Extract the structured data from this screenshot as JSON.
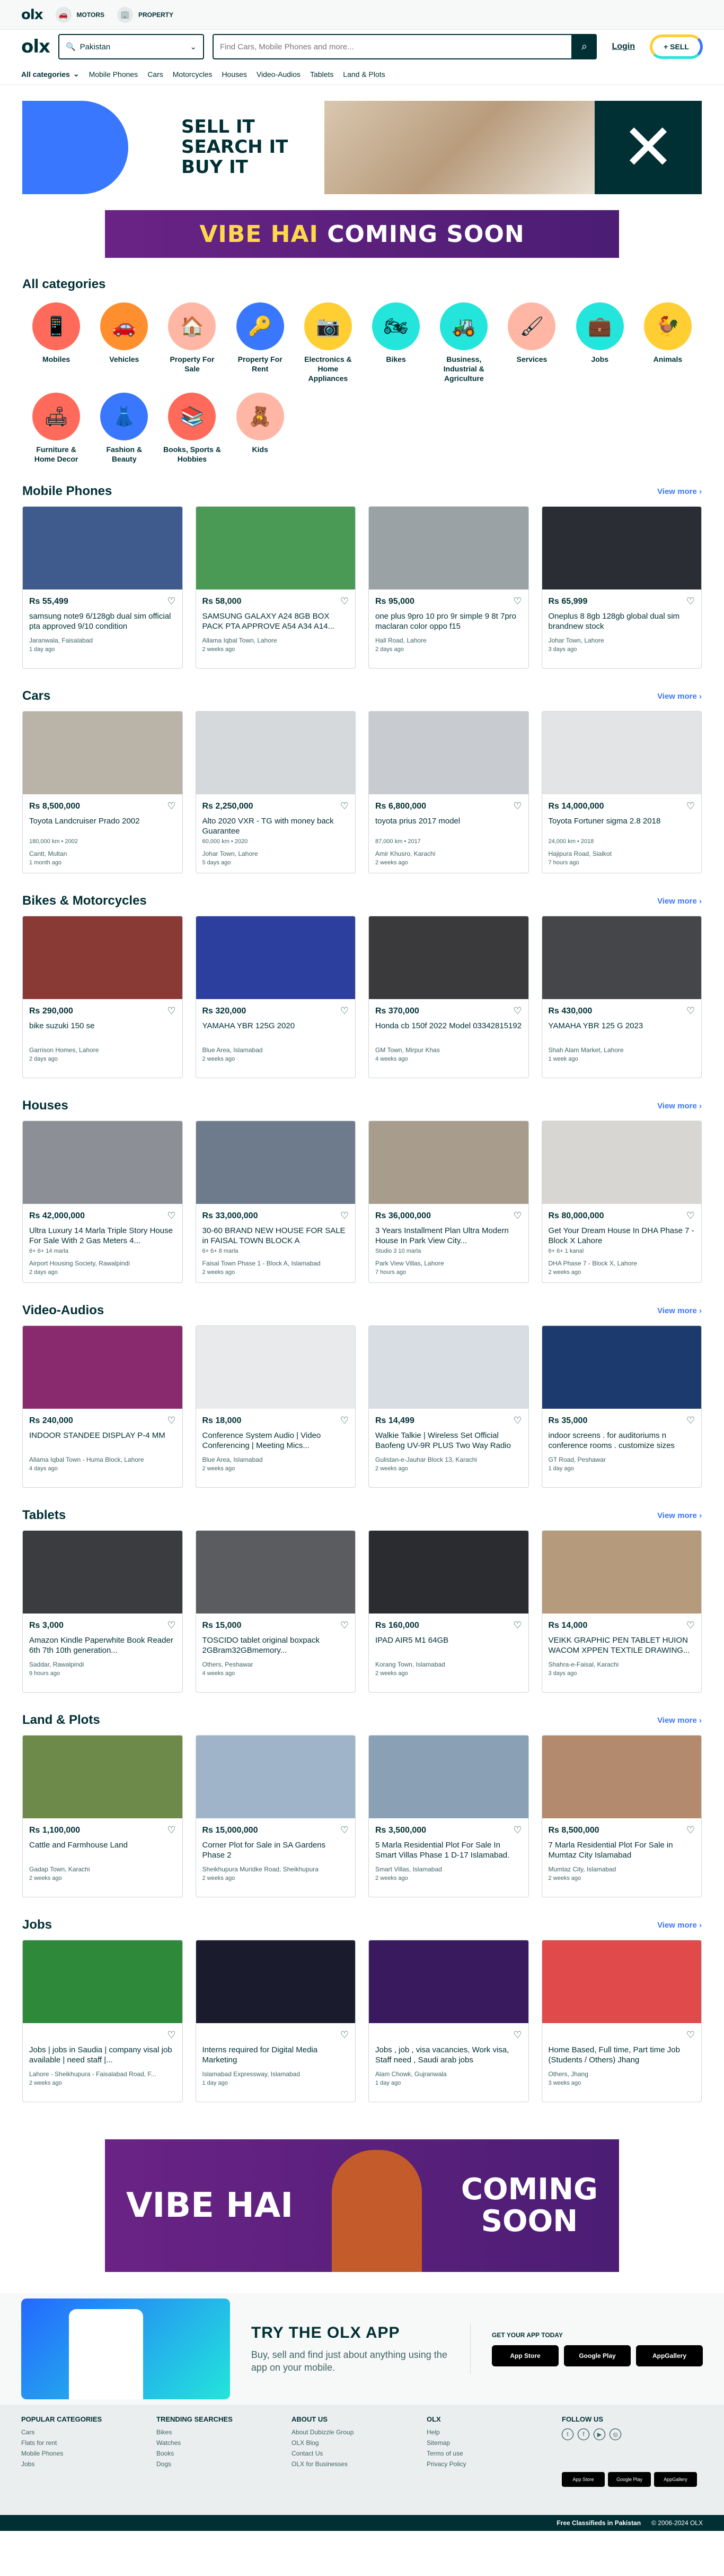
{
  "topbar": {
    "motors": "MOTORS",
    "property": "PROPERTY"
  },
  "header": {
    "location": "Pakistan",
    "search_placeholder": "Find Cars, Mobile Phones and more...",
    "login": "Login",
    "sell": "SELL"
  },
  "catnav": {
    "all": "All categories",
    "items": [
      "Mobile Phones",
      "Cars",
      "Motorcycles",
      "Houses",
      "Video-Audios",
      "Tablets",
      "Land & Plots"
    ]
  },
  "hero": {
    "l1": "SELL IT",
    "l2": "SEARCH IT",
    "l3": "BUY IT"
  },
  "ad1": {
    "a": "VIBE HAI",
    "b": "COMING SOON"
  },
  "categories": {
    "title": "All categories",
    "items": [
      {
        "label": "Mobiles",
        "icon": "📱",
        "bg": "#ff6a5a"
      },
      {
        "label": "Vehicles",
        "icon": "🚗",
        "bg": "#ff8f2e"
      },
      {
        "label": "Property For Sale",
        "icon": "🏠",
        "bg": "#ffb6a5"
      },
      {
        "label": "Property For Rent",
        "icon": "🔑",
        "bg": "#3a77ff"
      },
      {
        "label": "Electronics & Home Appliances",
        "icon": "📷",
        "bg": "#ffce32"
      },
      {
        "label": "Bikes",
        "icon": "🏍",
        "bg": "#23e5db"
      },
      {
        "label": "Business, Industrial & Agriculture",
        "icon": "🚜",
        "bg": "#23e5db"
      },
      {
        "label": "Services",
        "icon": "🖌",
        "bg": "#ffb6a5"
      },
      {
        "label": "Jobs",
        "icon": "💼",
        "bg": "#23e5db"
      },
      {
        "label": "Animals",
        "icon": "🐓",
        "bg": "#ffce32"
      },
      {
        "label": "Furniture & Home Decor",
        "icon": "🛋",
        "bg": "#ff6a5a"
      },
      {
        "label": "Fashion & Beauty",
        "icon": "👗",
        "bg": "#3a77ff"
      },
      {
        "label": "Books, Sports & Hobbies",
        "icon": "📚",
        "bg": "#ff6a5a"
      },
      {
        "label": "Kids",
        "icon": "🧸",
        "bg": "#ffb6a5"
      }
    ]
  },
  "view_more": "View more",
  "sections": [
    {
      "title": "Mobile Phones",
      "items": [
        {
          "price": "Rs 55,499",
          "title": "samsung note9 6/128gb dual sim official pta approved 9/10 condition",
          "meta": "",
          "loc": "Jaranwala, Faisalabad",
          "date": "1 day ago",
          "img": "#3f5a8c"
        },
        {
          "price": "Rs 58,000",
          "title": "SAMSUNG GALAXY A24 8GB BOX PACK PTA APPROVE A54 A34 A14...",
          "meta": "",
          "loc": "Allama Iqbal Town, Lahore",
          "date": "2 weeks ago",
          "img": "#4a9a55"
        },
        {
          "price": "Rs 95,000",
          "title": "one plus 9pro 10 pro 9r simple 9 8t 7pro maclaran color oppo f15",
          "meta": "",
          "loc": "Hall Road, Lahore",
          "date": "2 days ago",
          "img": "#9aa2a6"
        },
        {
          "price": "Rs 65,999",
          "title": "Oneplus 8 8gb 128gb global dual sim brandnew stock",
          "meta": "",
          "loc": "Johar Town, Lahore",
          "date": "3 days ago",
          "img": "#2a2d33"
        }
      ]
    },
    {
      "title": "Cars",
      "items": [
        {
          "price": "Rs 8,500,000",
          "title": "Toyota Landcruiser Prado 2002",
          "meta": "180,000 km • 2002",
          "loc": "Cantt, Multan",
          "date": "1 month ago",
          "img": "#b9b3a8"
        },
        {
          "price": "Rs 2,250,000",
          "title": "Alto 2020 VXR - TG with money back Guarantee",
          "meta": "60,000 km • 2020",
          "loc": "Johar Town, Lahore",
          "date": "5 days ago",
          "img": "#d6d9dc"
        },
        {
          "price": "Rs 6,800,000",
          "title": "toyota prius 2017 model",
          "meta": "87,000 km • 2017",
          "loc": "Amir Khusro, Karachi",
          "date": "2 weeks ago",
          "img": "#c8ccd0"
        },
        {
          "price": "Rs 14,000,000",
          "title": "Toyota Fortuner sigma 2.8 2018",
          "meta": "24,000 km • 2018",
          "loc": "Hajipura Road, Sialkot",
          "date": "7 hours ago",
          "img": "#e3e4e6"
        }
      ]
    },
    {
      "title": "Bikes & Motorcycles",
      "items": [
        {
          "price": "Rs 290,000",
          "title": "bike suzuki 150 se",
          "meta": "",
          "loc": "Garrison Homes, Lahore",
          "date": "2 days ago",
          "img": "#8a3a34"
        },
        {
          "price": "Rs 320,000",
          "title": "YAMAHA YBR 125G 2020",
          "meta": "",
          "loc": "Blue Area, Islamabad",
          "date": "2 weeks ago",
          "img": "#2d3f9e"
        },
        {
          "price": "Rs 370,000",
          "title": "Honda cb 150f 2022 Model 03342815192",
          "meta": "",
          "loc": "GM Town, Mirpur Khas",
          "date": "4 weeks ago",
          "img": "#3a3a3c"
        },
        {
          "price": "Rs 430,000",
          "title": "YAMAHA YBR 125 G 2023",
          "meta": "",
          "loc": "Shah Alam Market, Lahore",
          "date": "1 week ago",
          "img": "#44464a"
        }
      ]
    },
    {
      "title": "Houses",
      "items": [
        {
          "price": "Rs 42,000,000",
          "title": "Ultra Luxury 14 Marla Triple Story House For Sale With 2 Gas Meters 4...",
          "meta": "6+  6+  14 marla",
          "loc": "Airport Housing Society, Rawalpindi",
          "date": "2 days ago",
          "img": "#8c8f95"
        },
        {
          "price": "Rs 33,000,000",
          "title": "30-60 BRAND NEW HOUSE FOR SALE in FAISAL TOWN BLOCK A",
          "meta": "6+  6+  8 marla",
          "loc": "Faisal Town Phase 1 - Block A, Islamabad",
          "date": "2 weeks ago",
          "img": "#6e7b8c"
        },
        {
          "price": "Rs 36,000,000",
          "title": "3 Years Installment Plan Ultra Modern House In Park View City...",
          "meta": "Studio  3  10 marla",
          "loc": "Park View Villas, Lahore",
          "date": "7 hours ago",
          "img": "#a89c8c"
        },
        {
          "price": "Rs 80,000,000",
          "title": "Get Your Dream House In DHA Phase 7 - Block X Lahore",
          "meta": "6+  6+  1 kanal",
          "loc": "DHA Phase 7 - Block X, Lahore",
          "date": "2 weeks ago",
          "img": "#d8d6d2"
        }
      ]
    },
    {
      "title": "Video-Audios",
      "items": [
        {
          "price": "Rs 240,000",
          "title": "INDOOR STANDEE DISPLAY P-4 MM",
          "meta": "",
          "loc": "Allama Iqbal Town - Huma Block, Lahore",
          "date": "4 days ago",
          "img": "#8a2a6e"
        },
        {
          "price": "Rs 18,000",
          "title": "Conference System Audio | Video Conferencing | Meeting Mics...",
          "meta": "",
          "loc": "Blue Area, Islamabad",
          "date": "2 weeks ago",
          "img": "#e8eaec"
        },
        {
          "price": "Rs 14,499",
          "title": "Walkie Talkie | Wireless Set Official Baofeng UV-9R PLUS Two Way Radio",
          "meta": "",
          "loc": "Gulistan-e-Jauhar Block 13, Karachi",
          "date": "2 weeks ago",
          "img": "#d8dde4"
        },
        {
          "price": "Rs 35,000",
          "title": "indoor screens . for auditoriums n conference rooms . customize sizes",
          "meta": "",
          "loc": "GT Road, Peshawar",
          "date": "1 day ago",
          "img": "#1c3a6e"
        }
      ]
    },
    {
      "title": "Tablets",
      "items": [
        {
          "price": "Rs 3,000",
          "title": "Amazon Kindle Paperwhite Book Reader 6th 7th 10th generation...",
          "meta": "",
          "loc": "Saddar, Rawalpindi",
          "date": "9 hours ago",
          "img": "#3a3c40"
        },
        {
          "price": "Rs 15,000",
          "title": "TOSCIDO tablet original boxpack 2GBram32GBmemory...",
          "meta": "",
          "loc": "Others, Peshawar",
          "date": "4 weeks ago",
          "img": "#5a5c60"
        },
        {
          "price": "Rs 160,000",
          "title": "IPAD AIR5 M1 64GB",
          "meta": "",
          "loc": "Korang Town, Islamabad",
          "date": "2 weeks ago",
          "img": "#2a2c30"
        },
        {
          "price": "Rs 14,000",
          "title": "VEIKK GRAPHIC PEN TABLET HUION WACOM XPPEN TEXTILE DRAWING...",
          "meta": "",
          "loc": "Shahra-e-Faisal, Karachi",
          "date": "3 days ago",
          "img": "#b69a7c"
        }
      ]
    },
    {
      "title": "Land & Plots",
      "items": [
        {
          "price": "Rs 1,100,000",
          "title": "Cattle and Farmhouse Land",
          "meta": "",
          "loc": "Gadap Town, Karachi",
          "date": "2 weeks ago",
          "img": "#6e8a4a"
        },
        {
          "price": "Rs 15,000,000",
          "title": "Corner Plot for Sale in SA Gardens Phase 2",
          "meta": "",
          "loc": "Sheikhupura Muridke Road, Sheikhupura",
          "date": "2 weeks ago",
          "img": "#9fb4c8"
        },
        {
          "price": "Rs 3,500,000",
          "title": "5 Marla Residential Plot For Sale In Smart Villas Phase 1 D-17 Islamabad.",
          "meta": "",
          "loc": "Smart Villas, Islamabad",
          "date": "2 weeks ago",
          "img": "#8aa0b4"
        },
        {
          "price": "Rs 8,500,000",
          "title": "7 Marla Residential Plot For Sale in Mumtaz City Islamabad",
          "meta": "",
          "loc": "Mumtaz City, Islamabad",
          "date": "2 weeks ago",
          "img": "#b48a6e"
        }
      ]
    },
    {
      "title": "Jobs",
      "items": [
        {
          "price": "",
          "title": "Jobs | jobs in Saudia | company visal job available | need staff |...",
          "meta": "",
          "loc": "Lahore - Sheikhupura - Faisalabad Road, F...",
          "date": "2 weeks ago",
          "img": "#2e8a3a"
        },
        {
          "price": "",
          "title": "Interns required for Digital Media Marketing",
          "meta": "",
          "loc": "Islamabad Expressway, Islamabad",
          "date": "1 day ago",
          "img": "#1a1c2e"
        },
        {
          "price": "",
          "title": "Jobs , job , visa vacancies, Work visa, Staff need , Saudi arab jobs",
          "meta": "",
          "loc": "Alam Chowk, Gujranwala",
          "date": "1 day ago",
          "img": "#3a1a5e"
        },
        {
          "price": "",
          "title": "Home Based, Full time, Part time Job (Students / Others) Jhang",
          "meta": "",
          "loc": "Others, Jhang",
          "date": "3 weeks ago",
          "img": "#e04a4a"
        }
      ]
    }
  ],
  "ad2": {
    "a": "VIBE HAI",
    "b": "COMING",
    "c": "SOON"
  },
  "app": {
    "title": "TRY THE OLX APP",
    "desc": "Buy, sell and find just about anything using the app on your mobile.",
    "get": "GET YOUR APP TODAY",
    "app_store": "App Store",
    "google_play": "Google Play",
    "app_gallery": "AppGallery"
  },
  "footer": {
    "popular": {
      "title": "POPULAR CATEGORIES",
      "items": [
        "Cars",
        "Flats for rent",
        "Mobile Phones",
        "Jobs"
      ]
    },
    "trending": {
      "title": "TRENDING SEARCHES",
      "items": [
        "Bikes",
        "Watches",
        "Books",
        "Dogs"
      ]
    },
    "about": {
      "title": "ABOUT US",
      "items": [
        "About Dubizzle Group",
        "OLX Blog",
        "Contact Us",
        "OLX for Businesses"
      ]
    },
    "olx": {
      "title": "OLX",
      "items": [
        "Help",
        "Sitemap",
        "Terms of use",
        "Privacy Policy"
      ]
    },
    "follow": {
      "title": "FOLLOW US"
    }
  },
  "bottom": {
    "left": "Free Classifieds in Pakistan",
    "right": "© 2006-2024 OLX"
  }
}
